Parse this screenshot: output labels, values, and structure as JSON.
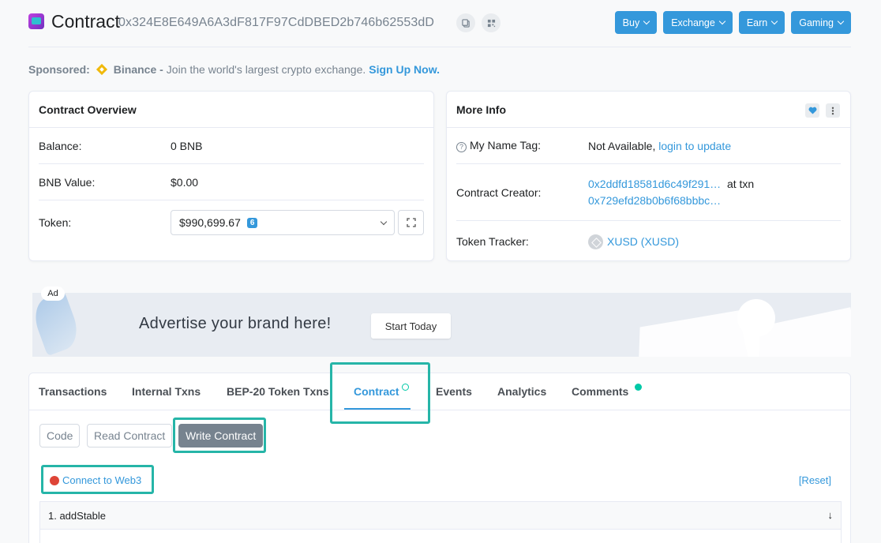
{
  "header": {
    "title": "Contract",
    "address": "0x324E8E649A6A3dF817F97CdDBED2b746b62553dD",
    "nav": [
      {
        "label": "Buy"
      },
      {
        "label": "Exchange"
      },
      {
        "label": "Earn"
      },
      {
        "label": "Gaming"
      }
    ]
  },
  "sponsored": {
    "prefix": "Sponsored:",
    "name": "Binance -",
    "text": "Join the world's largest crypto exchange.",
    "cta": "Sign Up Now."
  },
  "overview": {
    "title": "Contract Overview",
    "balance_label": "Balance:",
    "balance_value": "0 BNB",
    "value_label": "BNB Value:",
    "value_value": "$0.00",
    "token_label": "Token:",
    "token_value": "$990,699.67",
    "token_count": "6"
  },
  "more_info": {
    "title": "More Info",
    "name_tag_label": "My Name Tag:",
    "name_tag_value": "Not Available,",
    "name_tag_link": "login to update",
    "creator_label": "Contract Creator:",
    "creator_addr": "0x2ddfd18581d6c49f291…",
    "creator_at": "at txn",
    "creator_txn": "0x729efd28b0b6f68bbbc…",
    "tracker_label": "Token Tracker:",
    "tracker_value": "XUSD (XUSD)"
  },
  "ad": {
    "label": "Ad",
    "text": "Advertise your brand here!",
    "button": "Start Today"
  },
  "tabs": [
    {
      "label": "Transactions"
    },
    {
      "label": "Internal Txns"
    },
    {
      "label": "BEP-20 Token Txns"
    },
    {
      "label": "Contract"
    },
    {
      "label": "Events"
    },
    {
      "label": "Analytics"
    },
    {
      "label": "Comments"
    }
  ],
  "sub_tabs": [
    {
      "label": "Code"
    },
    {
      "label": "Read Contract"
    },
    {
      "label": "Write Contract"
    }
  ],
  "write": {
    "connect": "Connect to Web3",
    "reset": "[Reset]",
    "functions": [
      {
        "label": "1. addStable"
      }
    ]
  },
  "colors": {
    "accent": "#3498db",
    "highlight": "#26b5a8",
    "status_disconnected": "#de4437"
  }
}
